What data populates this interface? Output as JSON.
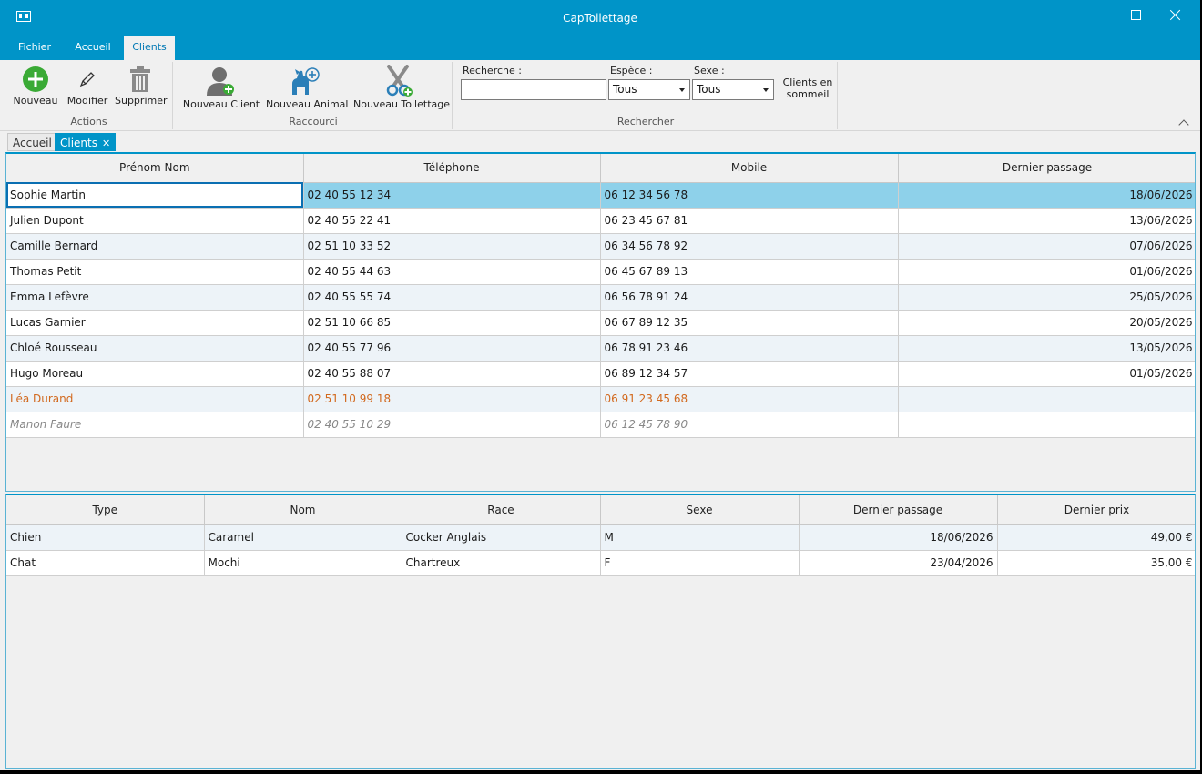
{
  "window": {
    "title": "CapToilettage"
  },
  "menu": {
    "tabs": [
      {
        "label": "Fichier"
      },
      {
        "label": "Accueil"
      },
      {
        "label": "Clients"
      }
    ]
  },
  "ribbon": {
    "actions": {
      "label": "Actions",
      "nouveau": "Nouveau",
      "modifier": "Modifier",
      "supprimer": "Supprimer"
    },
    "raccourci": {
      "label": "Raccourci",
      "nouveau_client": "Nouveau Client",
      "nouveau_animal": "Nouveau Animal",
      "nouveau_toilettage": "Nouveau Toilettage"
    },
    "rechercher": {
      "label": "Rechercher",
      "recherche_label": "Recherche :",
      "recherche_value": "",
      "espece_label": "Espèce :",
      "espece_value": "Tous",
      "sexe_label": "Sexe :",
      "sexe_value": "Tous",
      "sommeil_label": "Clients en sommeil"
    }
  },
  "doc_tabs": [
    {
      "label": "Accueil"
    },
    {
      "label": "Clients"
    }
  ],
  "clients": {
    "headers": [
      "Prénom Nom",
      "Téléphone",
      "Mobile",
      "Dernier passage"
    ],
    "rows": [
      {
        "name": "Sophie Martin",
        "phone": "02 40 55 12 34",
        "mobile": "06 12 34 56 78",
        "last": "18/06/2026",
        "state": "selected"
      },
      {
        "name": "Julien Dupont",
        "phone": "02 40 55 22 41",
        "mobile": "06 23 45 67 81",
        "last": "13/06/2026",
        "state": "normal"
      },
      {
        "name": "Camille Bernard",
        "phone": "02 51 10 33 52",
        "mobile": "06 34 56 78 92",
        "last": "07/06/2026",
        "state": "normal"
      },
      {
        "name": "Thomas Petit",
        "phone": "02 40 55 44 63",
        "mobile": "06 45 67 89 13",
        "last": "01/06/2026",
        "state": "normal"
      },
      {
        "name": "Emma Lefèvre",
        "phone": "02 40 55 55 74",
        "mobile": "06 56 78 91 24",
        "last": "25/05/2026",
        "state": "normal"
      },
      {
        "name": "Lucas Garnier",
        "phone": "02 51 10 66 85",
        "mobile": "06 67 89 12 35",
        "last": "20/05/2026",
        "state": "normal"
      },
      {
        "name": "Chloé Rousseau",
        "phone": "02 40 55 77 96",
        "mobile": "06 78 91 23 46",
        "last": "13/05/2026",
        "state": "normal"
      },
      {
        "name": "Hugo Moreau",
        "phone": "02 40 55 88 07",
        "mobile": "06 89 12 34 57",
        "last": "01/05/2026",
        "state": "normal"
      },
      {
        "name": "Léa Durand",
        "phone": "02 51 10 99 18",
        "mobile": "06 91 23 45 68",
        "last": "",
        "state": "warn"
      },
      {
        "name": "Manon Faure",
        "phone": "02 40 55 10 29",
        "mobile": "06 12 45 78 90",
        "last": "",
        "state": "sleep"
      }
    ]
  },
  "animals": {
    "headers": [
      "Type",
      "Nom",
      "Race",
      "Sexe",
      "Dernier passage",
      "Dernier prix"
    ],
    "rows": [
      {
        "type": "Chien",
        "name": "Caramel",
        "race": "Cocker Anglais",
        "sex": "M",
        "last": "18/06/2026",
        "price": "49,00 €"
      },
      {
        "type": "Chat",
        "name": "Mochi",
        "race": "Chartreux",
        "sex": "F",
        "last": "23/04/2026",
        "price": "35,00 €"
      }
    ]
  },
  "colors": {
    "accent": "#0094c8",
    "selected_row": "#8ed1ea",
    "warn": "#d2691e",
    "sleep": "#888888"
  }
}
